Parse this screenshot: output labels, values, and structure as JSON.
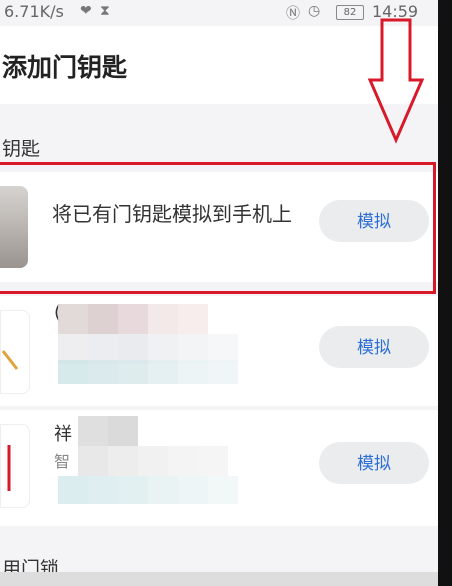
{
  "status_bar": {
    "network_speed": "6.71K/s",
    "battery": "82",
    "time": "14:59"
  },
  "header": {
    "title": "添加门钥匙"
  },
  "section": {
    "label": "钥匙"
  },
  "cards": [
    {
      "text": "将已有门钥匙模拟到手机上",
      "button": "模拟"
    },
    {
      "text": "",
      "button": "模拟"
    },
    {
      "text": "",
      "button": "模拟"
    }
  ],
  "partial_text": {
    "card3_fragment": "祥",
    "card3_fragment2": "智",
    "card2_fragment": "("
  },
  "footer": {
    "section_label": "用门锁"
  },
  "colors": {
    "accent": "#2d6fd6",
    "highlight": "#d8192a"
  },
  "icons": [
    "heart-icon",
    "hourglass-icon",
    "nfc-icon",
    "alarm-icon",
    "battery-icon",
    "down-arrow-annotation"
  ]
}
